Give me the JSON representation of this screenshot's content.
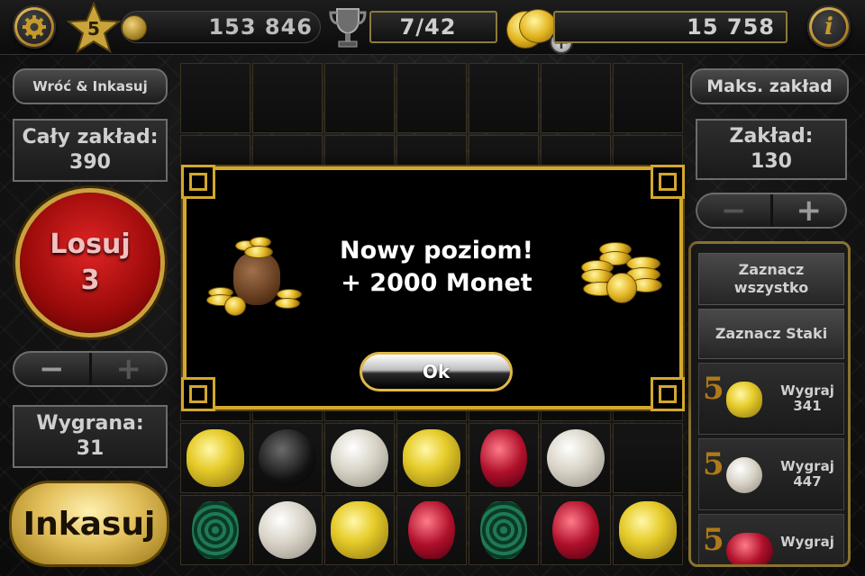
{
  "topbar": {
    "level": "5",
    "xp_value": "153 846",
    "achievements": "7/42",
    "coins": "15 758",
    "settings_icon": "gear-icon",
    "trophy_icon": "trophy-icon",
    "info_icon": "info-icon",
    "coin_add_icon": "coin-plus-icon"
  },
  "left": {
    "back_collect_label": "Wróć & Inkasuj",
    "total_bet_label": "Cały zakład:",
    "total_bet_value": "390",
    "spin_label": "Losuj",
    "spin_count": "3",
    "minus": "−",
    "plus": "+",
    "win_label": "Wygrana:",
    "win_value": "31",
    "collect_label": "Inkasuj"
  },
  "right": {
    "max_bet_label": "Maks. zakład",
    "bet_label": "Zakład:",
    "bet_value": "130",
    "minus": "−",
    "plus": "+",
    "select_all": "Zaznacz wszystko",
    "select_stakes": "Zaznacz Staki",
    "prizes": [
      {
        "count": "5",
        "label": "Wygraj",
        "value": "341",
        "gem": "yellow"
      },
      {
        "count": "5",
        "label": "Wygraj",
        "value": "447",
        "gem": "pearl"
      },
      {
        "count": "5",
        "label": "Wygraj",
        "value": "",
        "gem": "red"
      }
    ]
  },
  "popup": {
    "title_line1": "Nowy poziom!",
    "title_line2": "+ 2000 Monet",
    "ok_label": "Ok"
  },
  "board": {
    "row6": [
      "yellow",
      "black",
      "pearl",
      "yellow",
      "red",
      "pearl"
    ],
    "row7": [
      "green",
      "pearl",
      "yellow",
      "red",
      "green",
      "red",
      "yellow"
    ]
  }
}
